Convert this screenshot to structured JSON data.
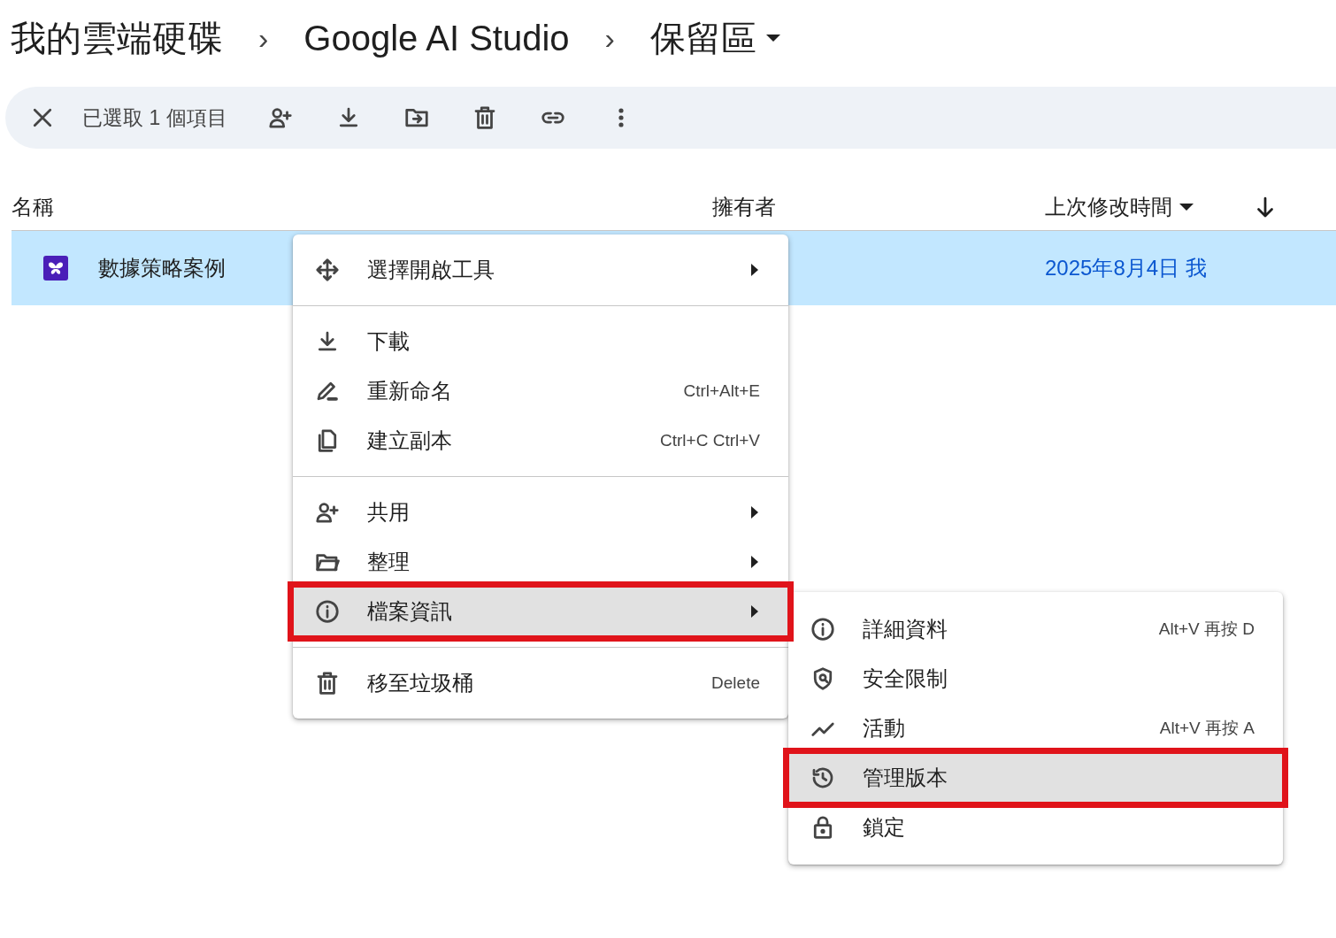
{
  "breadcrumb": {
    "items": [
      "我的雲端硬碟",
      "Google AI Studio",
      "保留區"
    ],
    "separator": "›"
  },
  "toolbar": {
    "selection": "已選取 1 個項目"
  },
  "table": {
    "columns": [
      "名稱",
      "擁有者",
      "上次修改時間"
    ],
    "rows": [
      {
        "name": "數據策略案例",
        "modified": "2025年8月4日 我",
        "selected": true
      }
    ]
  },
  "context_menu": {
    "groups": [
      [
        {
          "label": "選擇開啟工具",
          "submenu": true,
          "highlighted": false
        }
      ],
      [
        {
          "label": "下載",
          "submenu": false,
          "highlighted": false
        },
        {
          "label": "重新命名",
          "shortcut": "Ctrl+Alt+E",
          "submenu": false,
          "highlighted": false
        },
        {
          "label": "建立副本",
          "shortcut": "Ctrl+C Ctrl+V",
          "submenu": false,
          "highlighted": false
        }
      ],
      [
        {
          "label": "共用",
          "submenu": true,
          "highlighted": false
        },
        {
          "label": "整理",
          "submenu": true,
          "highlighted": false
        },
        {
          "label": "檔案資訊",
          "submenu": true,
          "highlighted": true
        }
      ],
      [
        {
          "label": "移至垃圾桶",
          "shortcut": "Delete",
          "submenu": false,
          "highlighted": false
        }
      ]
    ]
  },
  "submenu": {
    "items": [
      {
        "label": "詳細資料",
        "shortcut": "Alt+V 再按 D",
        "highlighted": false
      },
      {
        "label": "安全限制",
        "highlighted": false
      },
      {
        "label": "活動",
        "shortcut": "Alt+V 再按 A",
        "highlighted": false
      },
      {
        "label": "管理版本",
        "highlighted": true
      },
      {
        "label": "鎖定",
        "highlighted": false
      }
    ]
  }
}
